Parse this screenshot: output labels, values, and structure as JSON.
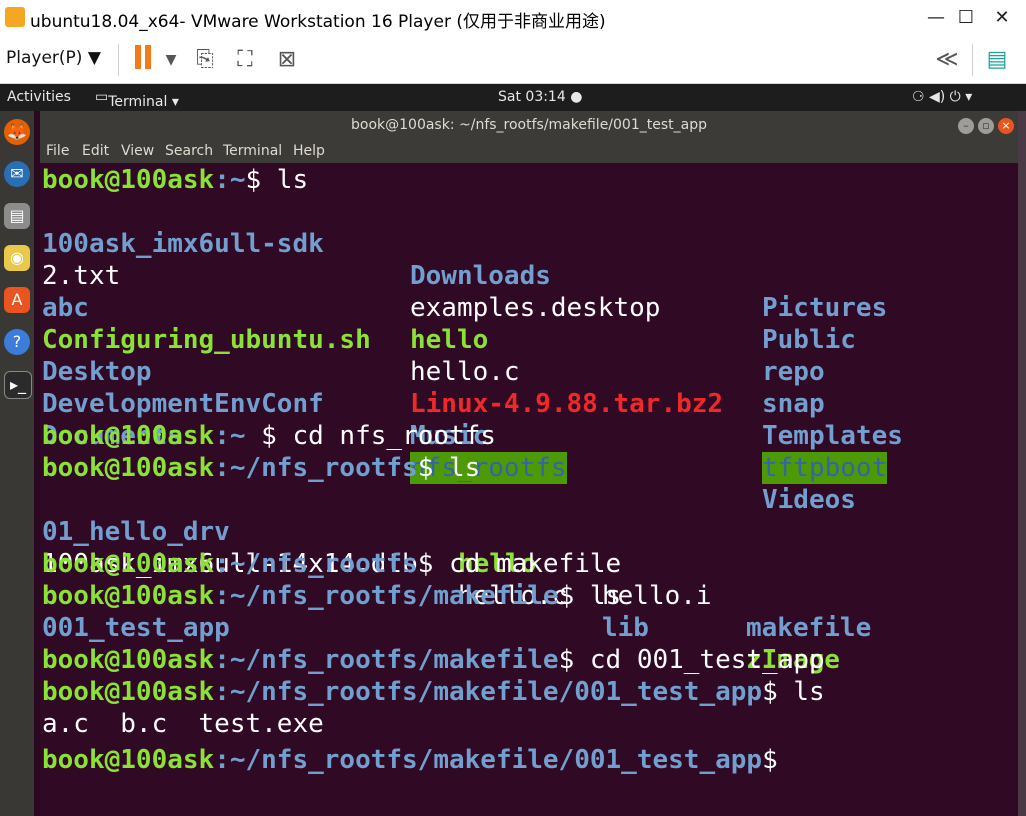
{
  "vmware": {
    "window_title": "ubuntu18.04_x64- VMware Workstation 16 Player (仅用于非商业用途)",
    "player_menu": "Player(P)",
    "controls": {
      "minimize": "—",
      "maximize": "☐",
      "close": "✕"
    },
    "toolbar_icons": [
      "pause-icon",
      "send-ctrl-alt-del-icon",
      "fullscreen-icon",
      "unity-icon",
      "collapse-icon",
      "notes-icon"
    ]
  },
  "gnome": {
    "activities": "Activities",
    "app_menu": "Terminal ▾",
    "clock": "Sat 03:14 ●",
    "status_icons": "⚆  ◀)  ⏻  ▾"
  },
  "dock": [
    "firefox-icon",
    "thunderbird-icon",
    "files-icon",
    "rhythmbox-icon",
    "software-center-icon",
    "help-icon",
    "terminal-icon"
  ],
  "terminal": {
    "title": "book@100ask: ~/nfs_rootfs/makefile/001_test_app",
    "menu": [
      "File",
      "Edit",
      "View",
      "Search",
      "Terminal",
      "Help"
    ],
    "prompt_user": "book@100ask",
    "lines": [
      {
        "path": ":~",
        "cmd": "$ ls"
      },
      {
        "path": ":~",
        "cmd": "$ cd nfs_rootfs"
      },
      {
        "path": ":~/nfs_rootfs",
        "cmd": "$ ls"
      },
      {
        "path": ":~/nfs_rootfs",
        "cmd": "$ cd makefile"
      },
      {
        "path": ":~/nfs_rootfs/makefile",
        "cmd": "$ ls"
      },
      {
        "path": ":~/nfs_rootfs/makefile",
        "cmd": "$ cd 001_test_app"
      },
      {
        "path": ":~/nfs_rootfs/makefile/001_test_app",
        "cmd": "$ ls"
      },
      {
        "path": ":~/nfs_rootfs/makefile/001_test_app",
        "cmd": "$"
      }
    ],
    "home_listing": [
      [
        "100ask_imx6ull-sdk",
        "Downloads",
        "Pictures"
      ],
      [
        "2.txt",
        "examples.desktop",
        "Public"
      ],
      [
        "abc",
        "hello",
        "repo"
      ],
      [
        "Configuring_ubuntu.sh",
        "hello.c",
        "snap"
      ],
      [
        "Desktop",
        "Linux-4.9.88.tar.bz2",
        "Templates"
      ],
      [
        "DevelopmentEnvConf",
        "Music",
        "tftpboot"
      ],
      [
        "Documents",
        "nfs_rootfs",
        "Videos"
      ]
    ],
    "nfs_listing": [
      [
        "01_hello_drv",
        "hello",
        "hello.i",
        "makefile"
      ],
      [
        "100ask_imx6ull-14x14.dtb",
        "hello.c",
        "lib",
        "zImage"
      ]
    ],
    "makefile_listing": "001_test_app",
    "app_listing": "a.c  b.c  test.exe"
  }
}
